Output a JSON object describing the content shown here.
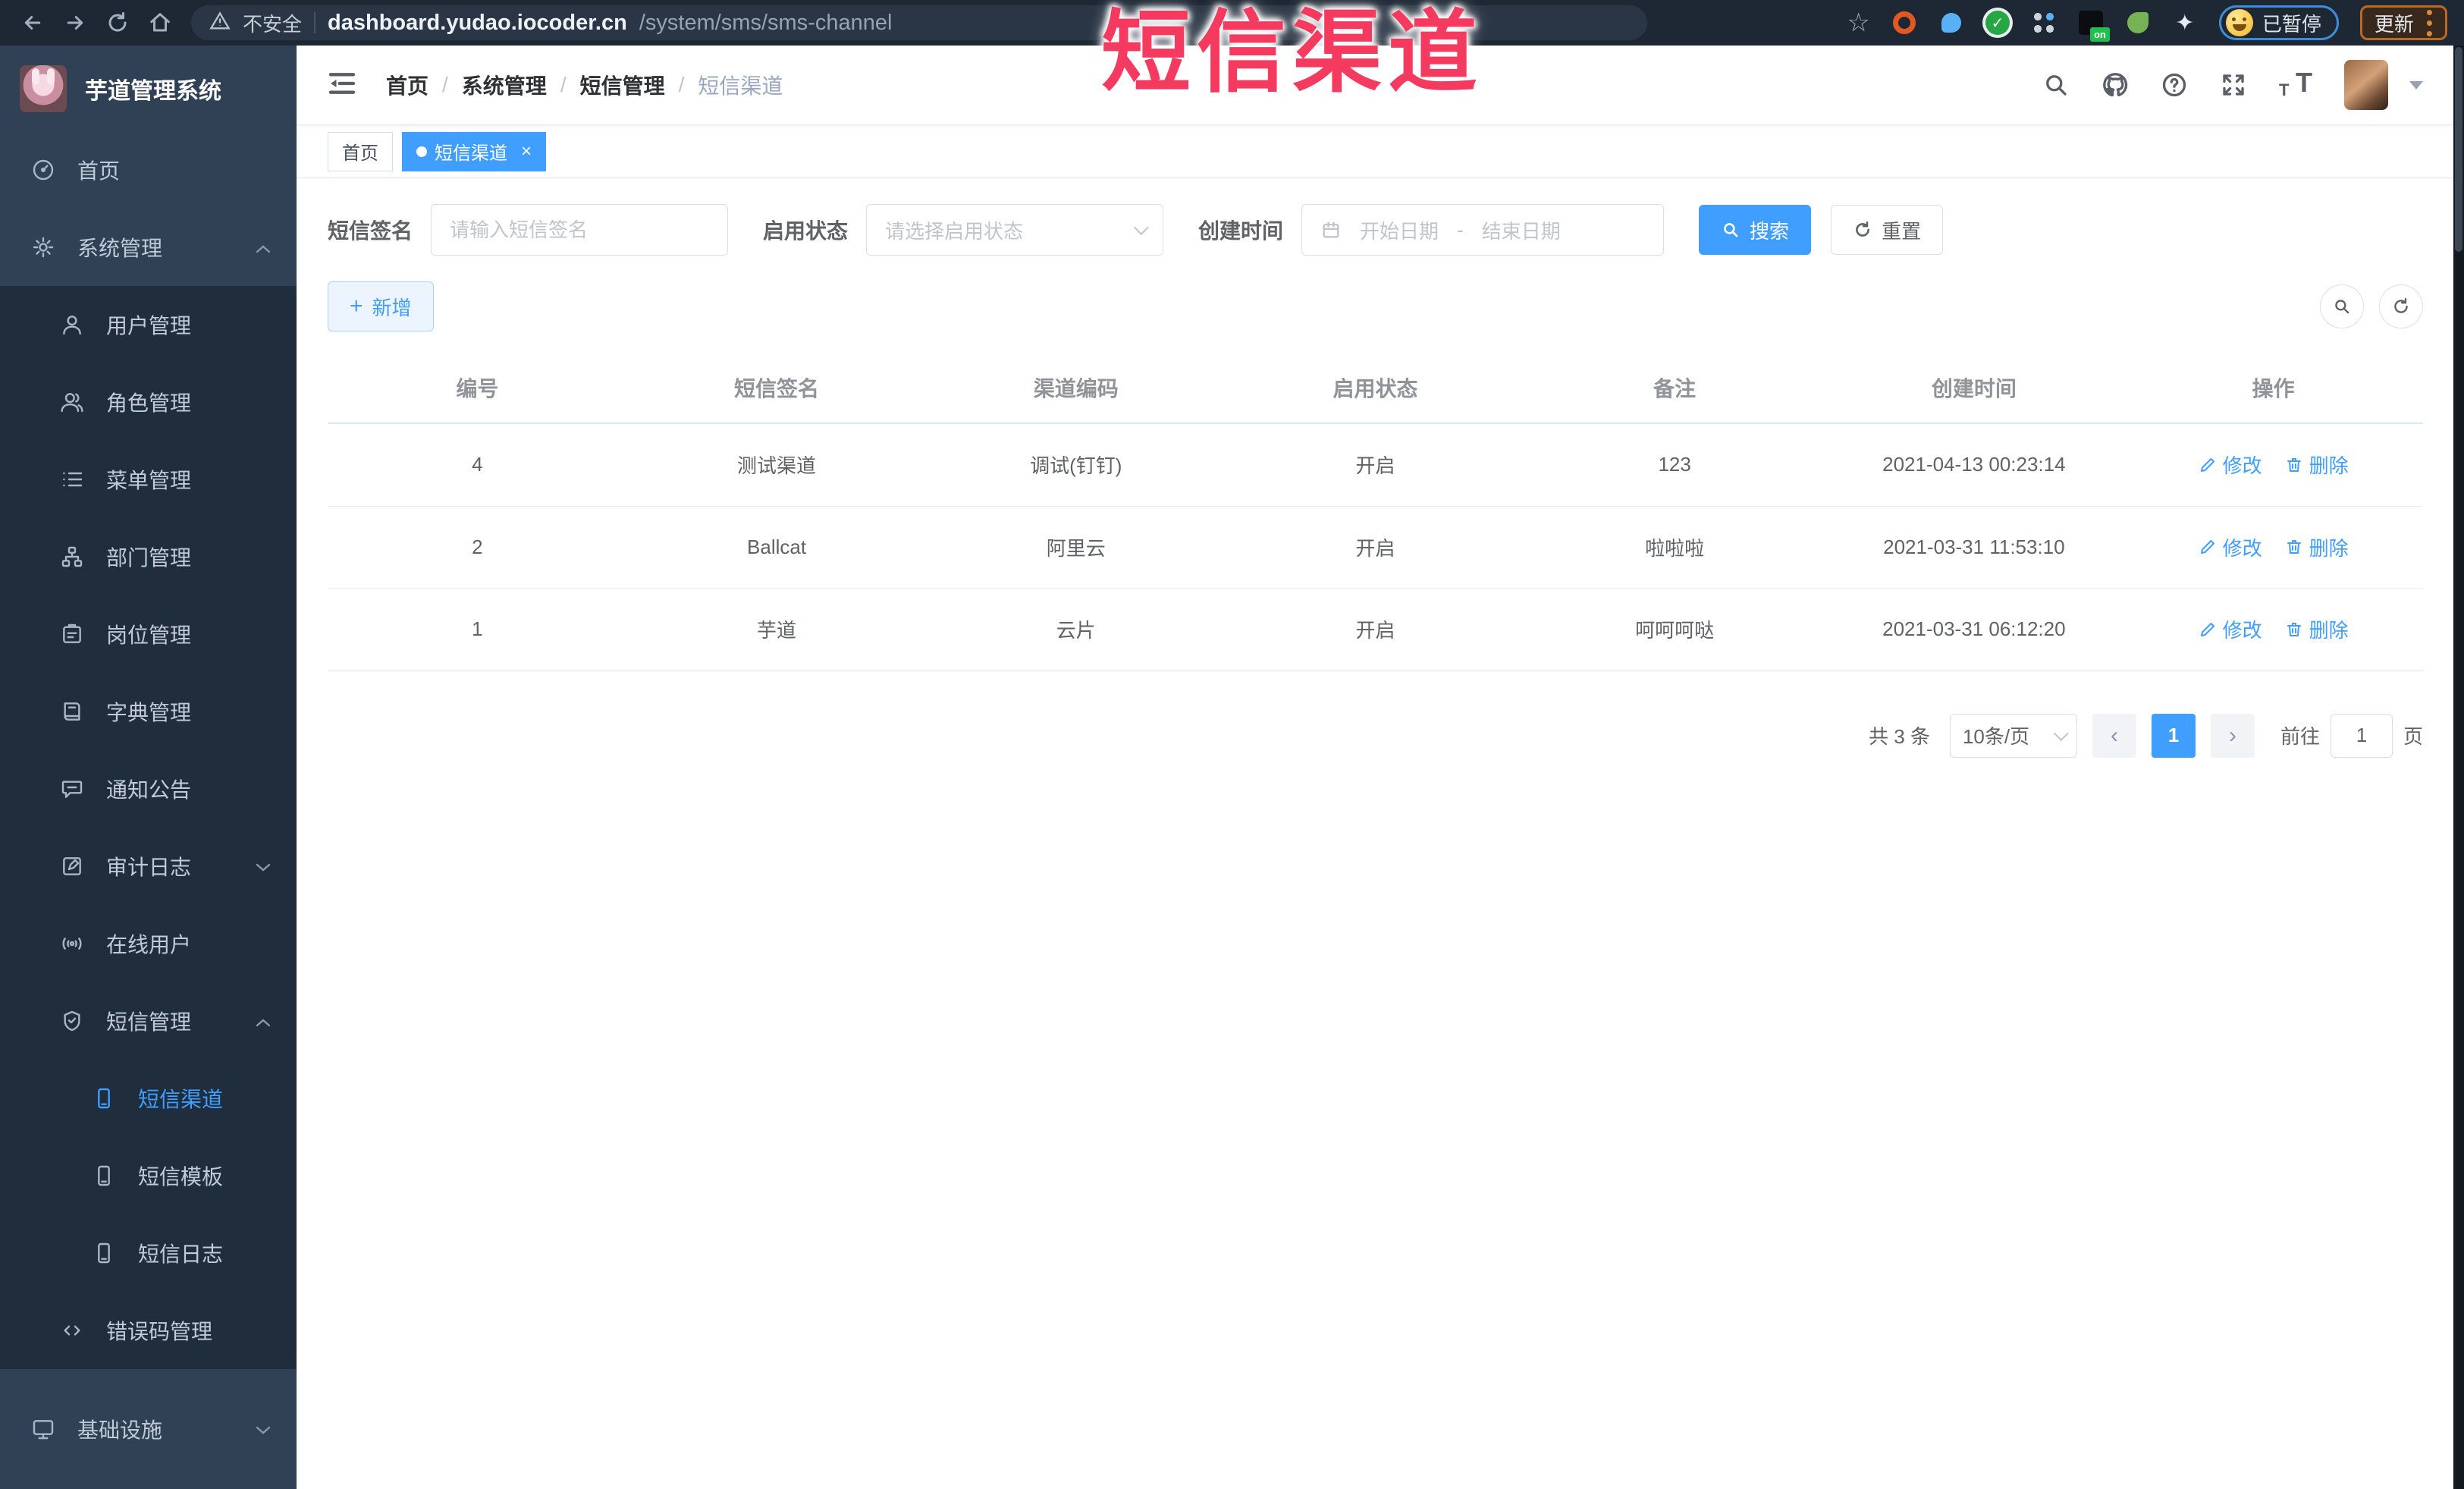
{
  "watermark": "短信渠道",
  "browser": {
    "security": "不安全",
    "host": "dashboard.yudao.iocoder.cn",
    "path": "/system/sms/sms-channel",
    "ext_badge": "on",
    "paused": "已暂停",
    "update": "更新"
  },
  "sidebar": {
    "title": "芋道管理系统",
    "items": [
      {
        "label": "首页"
      },
      {
        "label": "系统管理"
      },
      {
        "label": "用户管理"
      },
      {
        "label": "角色管理"
      },
      {
        "label": "菜单管理"
      },
      {
        "label": "部门管理"
      },
      {
        "label": "岗位管理"
      },
      {
        "label": "字典管理"
      },
      {
        "label": "通知公告"
      },
      {
        "label": "审计日志"
      },
      {
        "label": "在线用户"
      },
      {
        "label": "短信管理"
      },
      {
        "label": "短信渠道"
      },
      {
        "label": "短信模板"
      },
      {
        "label": "短信日志"
      },
      {
        "label": "错误码管理"
      },
      {
        "label": "基础设施"
      }
    ]
  },
  "breadcrumb": {
    "separator": "/",
    "items": [
      "首页",
      "系统管理",
      "短信管理",
      "短信渠道"
    ]
  },
  "tags": {
    "home": "首页",
    "active": "短信渠道"
  },
  "filters": {
    "sign_label": "短信签名",
    "sign_placeholder": "请输入短信签名",
    "status_label": "启用状态",
    "status_placeholder": "请选择启用状态",
    "time_label": "创建时间",
    "date_start": "开始日期",
    "date_separator": "-",
    "date_end": "结束日期",
    "search": "搜索",
    "reset": "重置"
  },
  "toolbar": {
    "add": "新增"
  },
  "table": {
    "headers": [
      "编号",
      "短信签名",
      "渠道编码",
      "启用状态",
      "备注",
      "创建时间",
      "操作"
    ],
    "op_edit": "修改",
    "op_delete": "删除",
    "rows": [
      {
        "id": "4",
        "sign": "测试渠道",
        "code": "调试(钉钉)",
        "status": "开启",
        "remark": "123",
        "created": "2021-04-13 00:23:14"
      },
      {
        "id": "2",
        "sign": "Ballcat",
        "code": "阿里云",
        "status": "开启",
        "remark": "啦啦啦",
        "created": "2021-03-31 11:53:10"
      },
      {
        "id": "1",
        "sign": "芋道",
        "code": "云片",
        "status": "开启",
        "remark": "呵呵呵哒",
        "created": "2021-03-31 06:12:20"
      }
    ]
  },
  "pagination": {
    "total": "共 3 条",
    "page_size": "10条/页",
    "prev": "‹",
    "page": "1",
    "next": "›",
    "goto_label": "前往",
    "goto_value": "1",
    "goto_unit": "页"
  },
  "colors": {
    "accent": "#409EFF",
    "watermark_red": "#F43A5E",
    "sidebar_bg": "#304156",
    "submenu_bg": "#1F2D3D"
  }
}
